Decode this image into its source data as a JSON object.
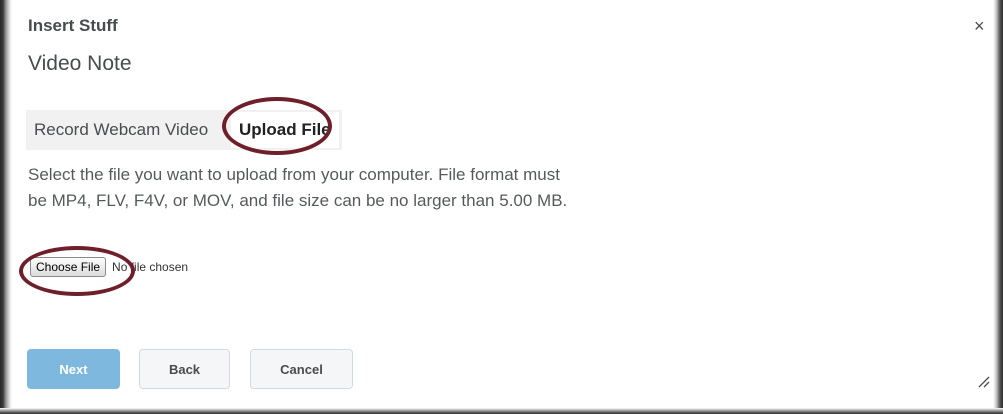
{
  "dialog": {
    "title": "Insert Stuff",
    "close_symbol": "×",
    "subtitle": "Video Note"
  },
  "tabs": {
    "record_label": "Record Webcam Video",
    "upload_label": "Upload File",
    "active": "Upload File"
  },
  "instructions": "Select the file you want to upload from your computer. File format must be MP4, FLV, F4V, or MOV, and file size can be no larger than 5.00 MB.",
  "file_input": {
    "button_label": "Choose File",
    "status_text": "No file chosen"
  },
  "footer": {
    "next_label": "Next",
    "back_label": "Back",
    "cancel_label": "Cancel"
  },
  "annotations": {
    "highlight_color": "#6e1f2a"
  },
  "colors": {
    "primary_button": "#7fb8de",
    "text": "#494c4e"
  },
  "icons": [
    "close-icon",
    "resize-handle-icon"
  ]
}
